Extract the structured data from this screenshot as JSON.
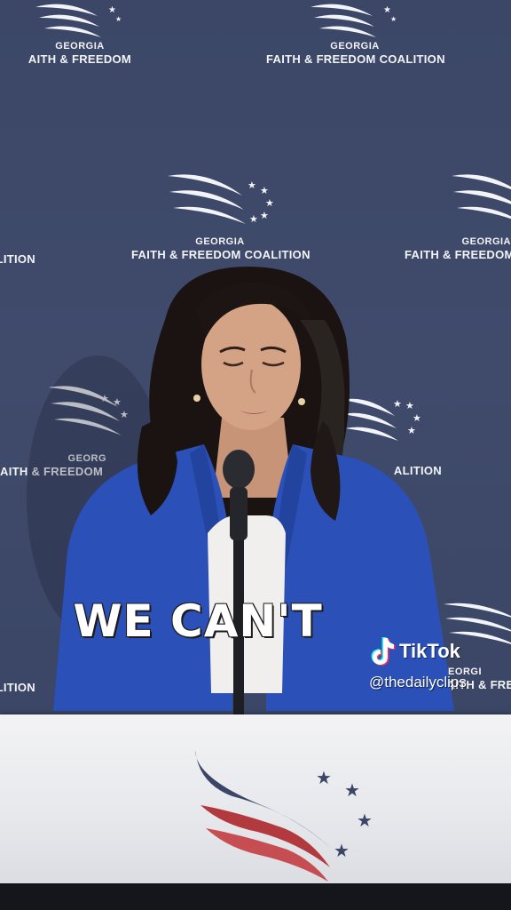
{
  "backdrop": {
    "logo_line1": "GEORGIA",
    "logo_line2": "FAITH & FREEDOM COALITION",
    "logo_line2_partial_right": "FAITH & FREEDOM",
    "logo_line2_partial_left": "AITH & FREEDOM",
    "logo_line2_partial_coalition": "COALITION",
    "logo_line2_partial_alition": "ALITION",
    "logo_line2_partial_oalition": "OALITION",
    "logo_line1_partial": "GEORG",
    "logo_line1_partial_right": "GEORGI"
  },
  "caption": {
    "text": "WE CAN'T"
  },
  "watermark": {
    "brand": "TikTok",
    "handle": "@thedailyclips"
  },
  "colors": {
    "backdrop": "#3f4a6b",
    "jacket": "#2d52b8",
    "podium": "#eeeef1",
    "caption": "#ffffff"
  }
}
